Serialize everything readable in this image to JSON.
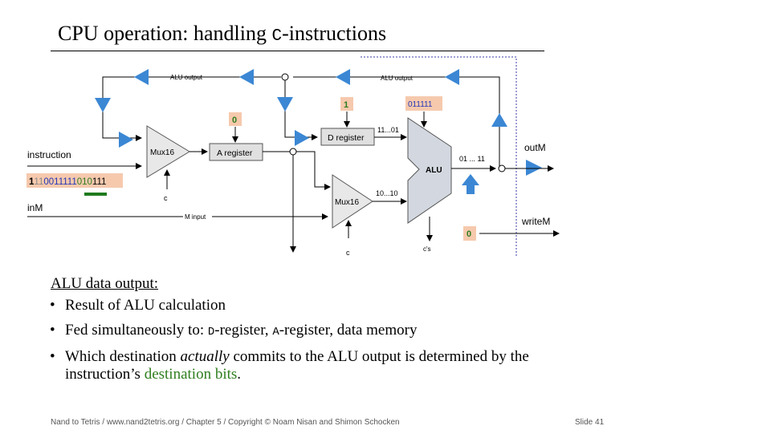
{
  "title": {
    "prefix": "CPU operation: handling ",
    "mono": "C",
    "suffix": "-instructions"
  },
  "diagram": {
    "alu_output_top": "ALU output",
    "alu_output_mid": "ALU output",
    "a_reg_load": "0",
    "d_reg_load": "1",
    "alu_control": "011111",
    "instruction_label": "instruction",
    "instruction_bits": {
      "first": "1",
      "grey": "11",
      "blue": "0011111",
      "green": "010",
      "last": "111"
    },
    "inM_label": "inM",
    "mux1_label": "Mux16",
    "a_register": "A register",
    "d_register": "D register",
    "mux2_label": "Mux16",
    "alu_label": "ALU",
    "d_out_bits": "11...01",
    "mux_out_bits": "10...10",
    "alu_out_bits": "01 ... 11",
    "outM_label": "outM",
    "writeM_label": "writeM",
    "writeM_value": "0",
    "m_input_label": "M input",
    "c_label_1": "c",
    "c_label_2": "c",
    "cs_label": "c's"
  },
  "section_title": "ALU data output:",
  "bullets": {
    "b1": "Result of ALU calculation",
    "b2_text": "Fed simultaneously to: ",
    "b2_d": "D",
    "b2_mid": "-register, ",
    "b2_a": "A",
    "b2_end": "-register, data memory",
    "b3_pre": "Which destination ",
    "b3_em": "actually",
    "b3_mid": " commits to the ALU output is determined by the instruction’s ",
    "b3_green": "destination bits",
    "b3_end": "."
  },
  "footer": "Nand to Tetris / www.nand2tetris.org / Chapter 5 / Copyright © Noam Nisan and Shimon Schocken",
  "slide_number": "Slide 41",
  "colors": {
    "arrow_blue": "#3b87d4",
    "highlight": "#f6c9ad",
    "green": "#2e7d1e",
    "alu_fill": "#d3d8e0",
    "gate_fill": "#e8e8e8"
  }
}
